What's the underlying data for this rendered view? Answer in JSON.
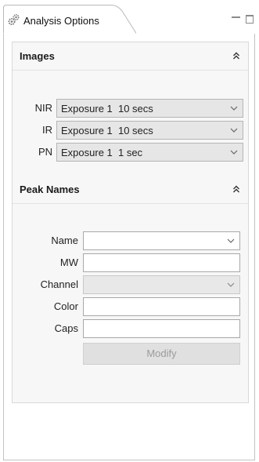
{
  "view": {
    "tab_title": "Analysis Options",
    "tab_icon": "gears-icon",
    "controls": [
      "minimize-icon",
      "maximize-icon"
    ]
  },
  "images_section": {
    "title": "Images",
    "rows": [
      {
        "label": "NIR",
        "value": "Exposure 1  10 secs"
      },
      {
        "label": "IR",
        "value": "Exposure 1  10 secs"
      },
      {
        "label": "PN",
        "value": "Exposure 1  1 sec"
      }
    ]
  },
  "peak_names_section": {
    "title": "Peak Names",
    "fields": {
      "name": {
        "label": "Name",
        "value": ""
      },
      "mw": {
        "label": "MW",
        "value": ""
      },
      "channel": {
        "label": "Channel",
        "value": ""
      },
      "color": {
        "label": "Color",
        "value": ""
      },
      "caps": {
        "label": "Caps",
        "value": ""
      }
    },
    "modify_label": "Modify"
  },
  "colors": {
    "section_bg": "#f7f7f7",
    "combo_bg": "#e6e6e6",
    "disabled_text": "#9b9b9b"
  }
}
